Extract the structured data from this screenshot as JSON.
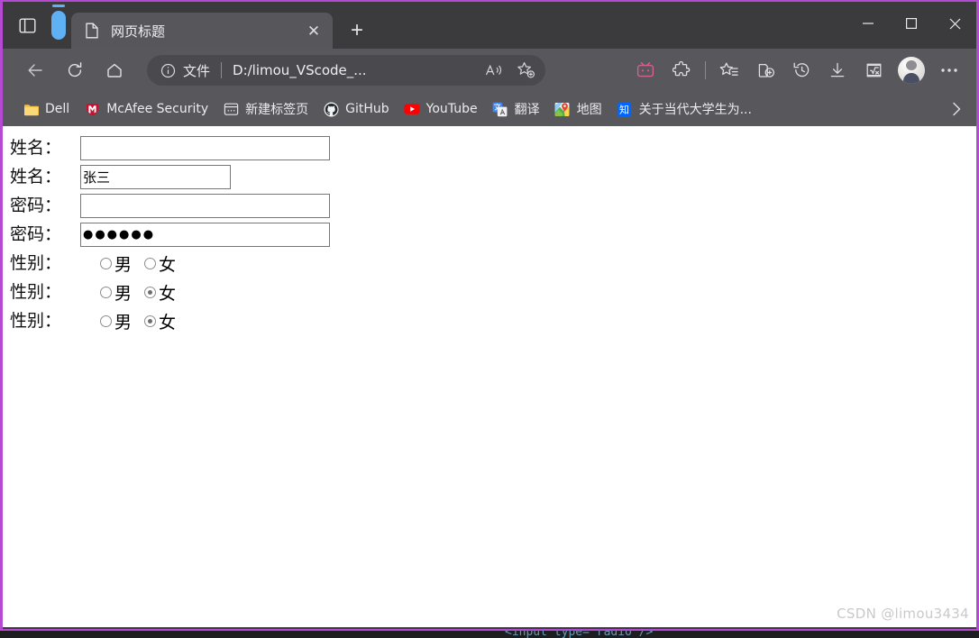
{
  "browser": {
    "window_controls": {
      "minimize": "—",
      "maximize": "☐",
      "close": "✕"
    },
    "tab_actions": {
      "collapse_sidebar_icon": "sidebar-icon",
      "vertical_tabs_icon": "vertical-tab-pill-icon",
      "new_tab_label": "+"
    },
    "tabs": [
      {
        "title": "网页标题",
        "favicon": "document-icon",
        "close": "✕",
        "active": true
      }
    ],
    "navigation": {
      "back_icon": "back-arrow-icon",
      "refresh_icon": "refresh-icon",
      "home_icon": "home-icon"
    },
    "omnibox": {
      "info_icon": "info-circle-icon",
      "scheme_label": "文件",
      "separator": "|",
      "url": "D:/limou_VScode_...",
      "read_aloud_icon": "read-aloud-icon",
      "favorite_icon": "add-favorite-star-icon"
    },
    "toolbar_actions": [
      {
        "name": "bilibili-extension-icon",
        "label": ""
      },
      {
        "name": "extensions-puzzle-icon",
        "label": ""
      },
      {
        "name": "divider",
        "label": ""
      },
      {
        "name": "favorites-icon",
        "label": ""
      },
      {
        "name": "collections-icon",
        "label": ""
      },
      {
        "name": "history-icon",
        "label": ""
      },
      {
        "name": "downloads-icon",
        "label": ""
      },
      {
        "name": "math-solver-icon",
        "label": ""
      },
      {
        "name": "profile-avatar",
        "label": ""
      },
      {
        "name": "settings-more-icon",
        "label": "···"
      }
    ],
    "bookmarks": [
      {
        "label": "Dell",
        "icon": "folder-icon"
      },
      {
        "label": "McAfee Security",
        "icon": "mcafee-shield-icon"
      },
      {
        "label": "新建标签页",
        "icon": "newtab-page-icon"
      },
      {
        "label": "GitHub",
        "icon": "github-icon"
      },
      {
        "label": "YouTube",
        "icon": "youtube-icon"
      },
      {
        "label": "翻译",
        "icon": "google-translate-icon"
      },
      {
        "label": "地图",
        "icon": "google-maps-icon"
      },
      {
        "label": "关于当代大学生为...",
        "icon": "zhihu-icon"
      }
    ],
    "bookmarks_overflow": "›"
  },
  "page": {
    "form_rows": [
      {
        "id": "name-empty",
        "label": "姓名：",
        "type": "text",
        "value": "",
        "width": "wide"
      },
      {
        "id": "name-filled",
        "label": "姓名：",
        "type": "text",
        "value": "张三",
        "width": "narrow"
      },
      {
        "id": "password-empty",
        "label": "密码：",
        "type": "password",
        "value": "",
        "width": "wide"
      },
      {
        "id": "password-filled",
        "label": "密码：",
        "type": "password",
        "value": "●●●●●●",
        "masked_length": 6,
        "width": "wide"
      },
      {
        "id": "gender-none",
        "label": "性别：",
        "type": "radio",
        "options": [
          {
            "label": "男",
            "checked": false
          },
          {
            "label": "女",
            "checked": false
          }
        ]
      },
      {
        "id": "gender-female-1",
        "label": "性别：",
        "type": "radio",
        "options": [
          {
            "label": "男",
            "checked": false
          },
          {
            "label": "女",
            "checked": true
          }
        ]
      },
      {
        "id": "gender-female-2",
        "label": "性别：",
        "type": "radio",
        "options": [
          {
            "label": "男",
            "checked": false
          },
          {
            "label": "女",
            "checked": true
          }
        ]
      }
    ],
    "watermark": "CSDN @limou3434"
  },
  "colors": {
    "window_border": "#b44ad1",
    "titlebar_bg": "#3b3b3e",
    "toolbar_bg": "#58585c",
    "active_tab_bg": "#57575b",
    "omnibox_bg": "#4a4a4e",
    "page_bg": "#ffffff",
    "input_border": "#767676",
    "watermark_color": "#c9c9c9",
    "vertical_tab_accent": "#60b0f4"
  }
}
